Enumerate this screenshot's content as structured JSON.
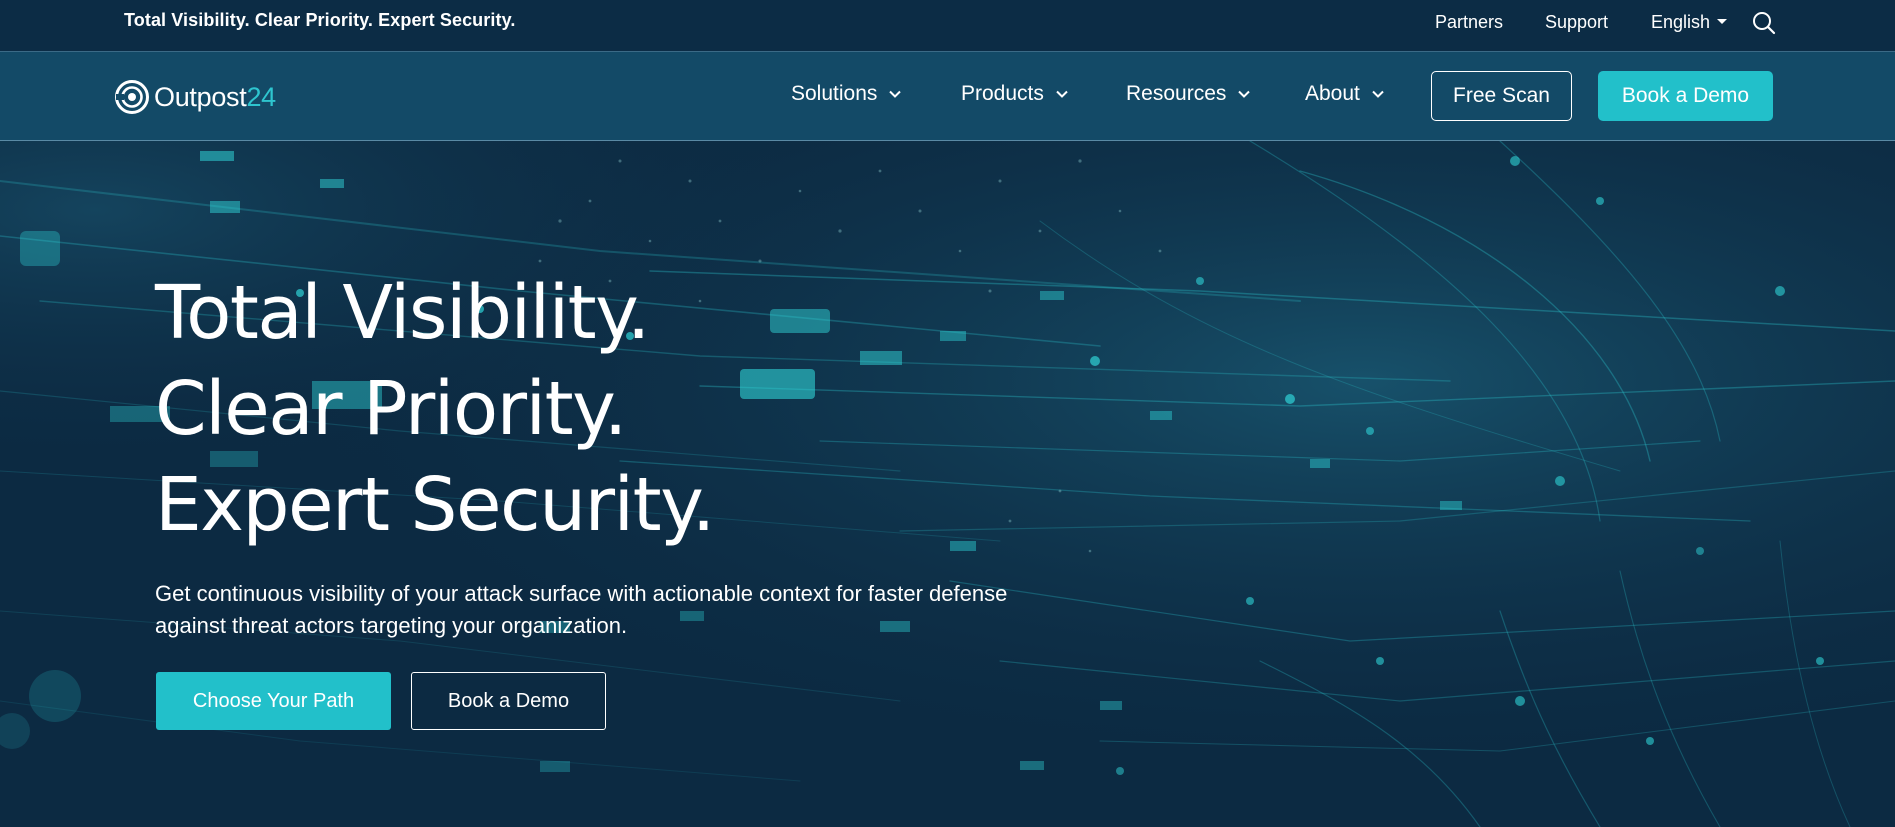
{
  "topbar": {
    "tagline": "Total Visibility. Clear Priority. Expert Security.",
    "partners": "Partners",
    "support": "Support",
    "language": "English",
    "search_icon": "search-icon"
  },
  "nav": {
    "logo_word": "Outpost",
    "logo_number": "24",
    "logo_icon": "outpost24-logo-icon",
    "items": [
      {
        "label": "Solutions"
      },
      {
        "label": "Products"
      },
      {
        "label": "Resources"
      },
      {
        "label": "About"
      }
    ],
    "free_scan": "Free Scan",
    "book_demo": "Book a Demo"
  },
  "hero": {
    "headline": [
      "Total Visibility.",
      "Clear Priority.",
      "Expert Security."
    ],
    "subtext": "Get continuous visibility of your attack surface with actionable context for faster defense against threat actors targeting your organization.",
    "primary_cta": "Choose Your Path",
    "secondary_cta": "Book a Demo"
  },
  "colors": {
    "accent": "#22c0ca",
    "topbar_bg": "#0c2c45",
    "nav_bg": "#134a67",
    "hero_bg": "#0c2a42"
  }
}
